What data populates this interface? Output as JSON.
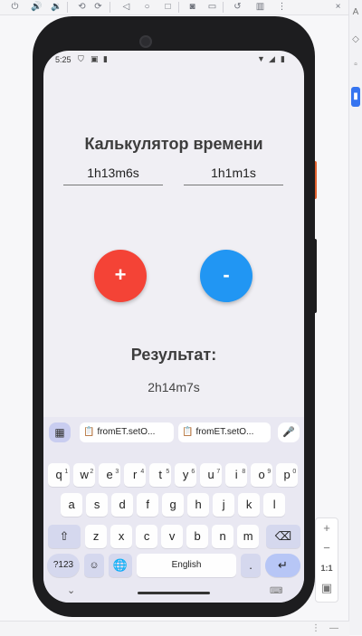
{
  "ide": {
    "toolbar_icons": [
      "clock-icon",
      "volume-up-icon",
      "volume-down-icon",
      "rotate-left-icon",
      "rotate-right-icon",
      "back-icon",
      "home-icon",
      "overview-icon",
      "camera-icon",
      "video-icon",
      "restore-icon",
      "pair-icon",
      "more-icon"
    ],
    "zoom": {
      "plus": "+",
      "minus": "−",
      "one_to_one": "1:1"
    }
  },
  "status_bar": {
    "time": "5:25"
  },
  "app": {
    "title": "Калькулятор времени",
    "input_left": "1h13m6s",
    "input_right": "1h1m1s",
    "plus_label": "+",
    "minus_label": "-",
    "result_label": "Результат:",
    "result_value": "2h14m7s",
    "colors": {
      "plus": "#f44336",
      "minus": "#2196f3"
    }
  },
  "keyboard": {
    "suggestions": [
      "fromET.setO...",
      "fromET.setO..."
    ],
    "row1": [
      [
        "q",
        "1"
      ],
      [
        "w",
        "2"
      ],
      [
        "e",
        "3"
      ],
      [
        "r",
        "4"
      ],
      [
        "t",
        "5"
      ],
      [
        "y",
        "6"
      ],
      [
        "u",
        "7"
      ],
      [
        "i",
        "8"
      ],
      [
        "o",
        "9"
      ],
      [
        "p",
        "0"
      ]
    ],
    "row2": [
      "a",
      "s",
      "d",
      "f",
      "g",
      "h",
      "j",
      "k",
      "l"
    ],
    "row3": [
      "z",
      "x",
      "c",
      "v",
      "b",
      "n",
      "m"
    ],
    "symbols_label": "?123",
    "space_label": "English",
    "period_label": "."
  }
}
